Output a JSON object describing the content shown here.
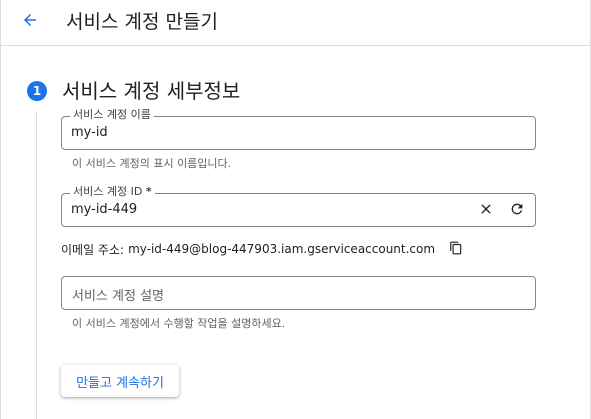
{
  "header": {
    "title": "서비스 계정 만들기"
  },
  "step": {
    "number": "1",
    "title": "서비스 계정 세부정보"
  },
  "fields": {
    "name": {
      "label": "서비스 계정 이름",
      "value": "my-id",
      "hint": "이 서비스 계정의 표시 이름입니다."
    },
    "id": {
      "label": "서비스 계정 ID",
      "required_mark": "*",
      "value": "my-id-449"
    },
    "description": {
      "placeholder": "서비스 계정 설명",
      "hint": "이 서비스 계정에서 수행할 작업을 설명하세요."
    }
  },
  "email": {
    "label": "이메일 주소:",
    "value": "my-id-449@blog-447903.iam.gserviceaccount.com"
  },
  "actions": {
    "create_continue_label": "만들고 계속하기"
  },
  "colors": {
    "accent": "#1a73e8",
    "border": "#80868b",
    "divider": "#dadce0"
  }
}
